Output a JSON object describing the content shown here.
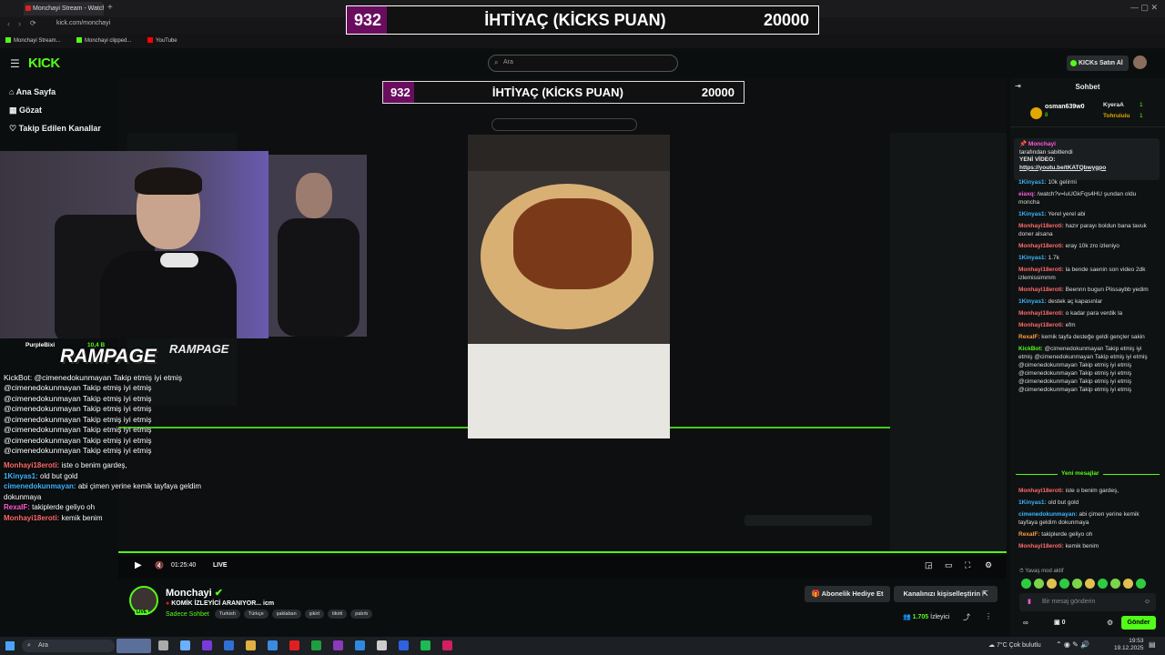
{
  "browser": {
    "tab_title": "Monchayi Stream - Watch",
    "url": "kick.com/monchayi",
    "bookmarks": [
      "Monchayi Stream...",
      "Monchayi clipped...",
      "YouTube"
    ]
  },
  "overlay": {
    "left": "932",
    "title": "İHTİYAÇ (KİCKS PUAN)",
    "right": "20000"
  },
  "header": {
    "logo": "KICK",
    "search_placeholder": "Ara",
    "kicks_button": "KICKs Satın Al"
  },
  "sidebar": {
    "items": [
      "Ana Sayfa",
      "Gözat",
      "Takip Edilen Kanallar"
    ]
  },
  "webcam_chat": {
    "badge_user": "PurpleBixi",
    "badge_count": "10,4 B",
    "rampage": "RAMPAGE",
    "kickbot_line": "KickBot: @cimenedokunmayan Takip etmiş iyi etmiş",
    "repeat_line": "@cimenedokunmayan Takip etmiş iyi etmiş",
    "messages": [
      {
        "user": "Monhayi18eroti:",
        "text": "iste o benim gardeş,"
      },
      {
        "user": "1Kinyas1:",
        "text": "old but gold"
      },
      {
        "user": "cimenedokunmayan:",
        "text": "abi çimen yerine kemik tayfaya geldim dokunmaya"
      },
      {
        "user": "RexaIF:",
        "text": "takiplerde geliyo oh"
      },
      {
        "user": "Monhayi18eroti:",
        "text": "kemik benim"
      }
    ]
  },
  "player": {
    "time": "01:25:40",
    "live": "LIVE"
  },
  "channel": {
    "name": "Monchayi",
    "title": "KOMİK İZLEYİCİ ARANIYOR... icm",
    "category": "Sadece Sohbet",
    "tags": [
      "Turkish",
      "Türkçe",
      "şaklaban",
      "şikirt",
      "tikirti",
      "patırtı"
    ],
    "viewers": "1.705",
    "viewers_label": "İzleyici",
    "gift_button": "Abonelik Hediye Et",
    "customize_button": "Kanalınızı kişiselleştirin",
    "live_badge": "LIVE"
  },
  "chat": {
    "title": "Sohbet",
    "top_user": "osman639w0",
    "top_user_count": "8",
    "top_user2": "KyeraA",
    "top_user2_count": "1",
    "top_user3": "Tohruiuiu",
    "top_user3_count": "1",
    "pinned_user": "Monchayi",
    "pinned_by": "tarafından sabitlendi",
    "pinned_text": "YENİ VİDEO:",
    "pinned_link": "https://youtu.be/tKATQbwygpo",
    "messages": [
      {
        "user": "1Kinyas1:",
        "text": "10k gelirmi",
        "color": "#3db5ff"
      },
      {
        "user": "eiaxq:",
        "text": "/watch?v=luUGkFqs4HU şundan oldu moncha",
        "color": "#ff5bd9"
      },
      {
        "user": "1Kinyas1:",
        "text": "Yerel yerel abi",
        "color": "#3db5ff"
      },
      {
        "user": "Monhayi18eroti:",
        "text": "hazır parayı boldun bana tavuk doner alsana",
        "color": "#ff6a6a"
      },
      {
        "user": "Monhayi18eroti:",
        "text": "eray 10k zro izleniyo",
        "color": "#ff6a6a"
      },
      {
        "user": "1Kinyas1:",
        "text": "1.7k",
        "color": "#3db5ff"
      },
      {
        "user": "Monhayi18eroti:",
        "text": "la bende saenin son video 2dk izlemissimmm",
        "color": "#ff6a6a"
      },
      {
        "user": "Monhayi18eroti:",
        "text": "Beennn bugun Plissaybb yedim",
        "color": "#ff6a6a"
      },
      {
        "user": "1Kinyas1:",
        "text": "destek aç kapasınlar",
        "color": "#3db5ff"
      },
      {
        "user": "Monhayi18eroti:",
        "text": "o kadar para verdik la",
        "color": "#ff6a6a"
      },
      {
        "user": "Monhayi18eroti:",
        "text": "efm",
        "color": "#ff6a6a"
      },
      {
        "user": "RexaIF:",
        "text": "kemik tayfa desteğe geldi gençler sakin",
        "color": "#ff9c40"
      },
      {
        "user": "KickBot:",
        "text": "@cimenedokunmayan Takip etmiş iyi etmiş @cimenedokunmayan Takip etmiş iyi etmiş @cimenedokunmayan Takip etmiş iyi etmiş @cimenedokunmayan Takip etmiş iyi etmiş @cimenedokunmayan Takip etmiş iyi etmiş @cimenedokunmayan Takip etmiş iyi etmiş",
        "color": "#53fc18"
      }
    ],
    "new_messages": "Yeni mesajlar",
    "messages2": [
      {
        "user": "Monhayi18eroti:",
        "text": "iste o benim gardeş,",
        "color": "#ff6a6a"
      },
      {
        "user": "1Kinyas1:",
        "text": "old but gold",
        "color": "#3db5ff"
      },
      {
        "user": "cimenedokunmayan:",
        "text": "abi çimen yerine kemik tayfaya geldim dokunmaya",
        "color": "#3db5ff"
      },
      {
        "user": "RexaIF:",
        "text": "takiplerde geliyo oh",
        "color": "#ff9c40"
      },
      {
        "user": "Monhayi18eroti:",
        "text": "kemik benim",
        "color": "#ff6a6a"
      }
    ],
    "slow_mode": "Yavaş mod aktif",
    "input_placeholder": "Bir mesaj gönderin",
    "points": "0",
    "send": "Gönder"
  },
  "taskbar": {
    "search": "Ara",
    "weather": "7°C  Çok bulutlu",
    "time": "19:53",
    "date": "19.12.2025"
  },
  "colors": {
    "kick_green": "#53fc18",
    "overlay_purple": "#6a0d5e",
    "bg": "#0b0e0f"
  }
}
